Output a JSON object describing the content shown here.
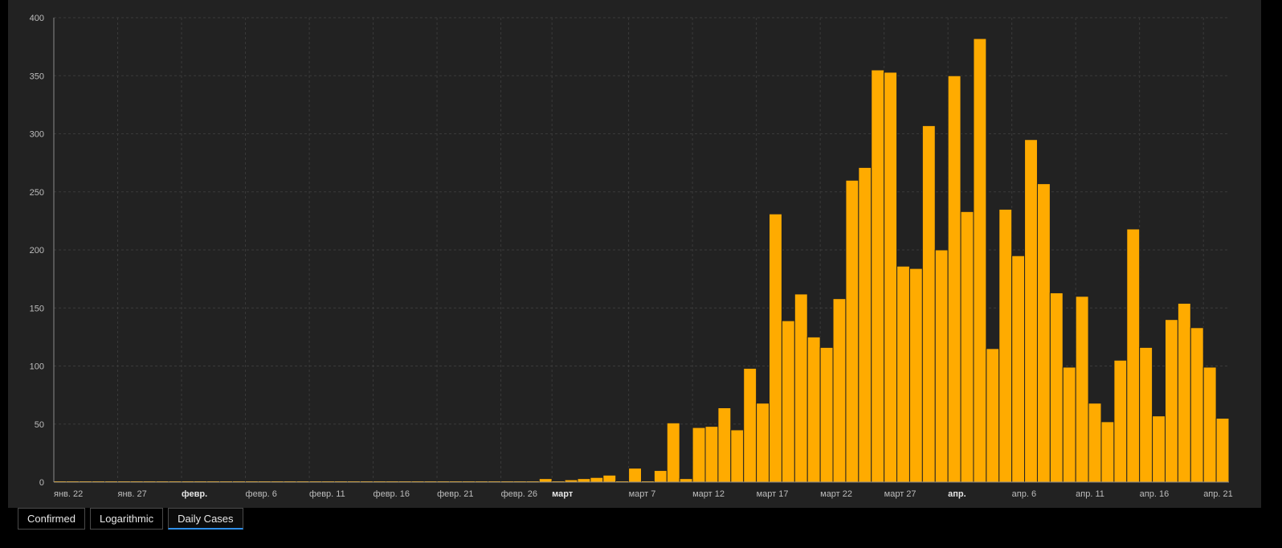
{
  "tabs": [
    {
      "label": "Confirmed",
      "active": false
    },
    {
      "label": "Logarithmic",
      "active": false
    },
    {
      "label": "Daily Cases",
      "active": true
    }
  ],
  "chart_data": {
    "type": "bar",
    "title": "",
    "xlabel": "",
    "ylabel": "",
    "ylim": [
      0,
      400
    ],
    "yticks": [
      0,
      50,
      100,
      150,
      200,
      250,
      300,
      350,
      400
    ],
    "grid": true,
    "bar_color": "#ffab00",
    "background": "#222222",
    "x_tick_labels": [
      {
        "index": 0,
        "label": "янв. 22",
        "major": false
      },
      {
        "index": 5,
        "label": "янв. 27",
        "major": false
      },
      {
        "index": 10,
        "label": "февр.",
        "major": true
      },
      {
        "index": 15,
        "label": "февр. 6",
        "major": false
      },
      {
        "index": 20,
        "label": "февр. 11",
        "major": false
      },
      {
        "index": 25,
        "label": "февр. 16",
        "major": false
      },
      {
        "index": 30,
        "label": "февр. 21",
        "major": false
      },
      {
        "index": 35,
        "label": "февр. 26",
        "major": false
      },
      {
        "index": 39,
        "label": "март",
        "major": true
      },
      {
        "index": 45,
        "label": "март 7",
        "major": false
      },
      {
        "index": 50,
        "label": "март 12",
        "major": false
      },
      {
        "index": 55,
        "label": "март 17",
        "major": false
      },
      {
        "index": 60,
        "label": "март 22",
        "major": false
      },
      {
        "index": 65,
        "label": "март 27",
        "major": false
      },
      {
        "index": 70,
        "label": "апр.",
        "major": true
      },
      {
        "index": 75,
        "label": "апр. 6",
        "major": false
      },
      {
        "index": 80,
        "label": "апр. 11",
        "major": false
      },
      {
        "index": 85,
        "label": "апр. 16",
        "major": false
      },
      {
        "index": 90,
        "label": "апр. 21",
        "major": false
      }
    ],
    "values": [
      0,
      0,
      0,
      0,
      0,
      0,
      0,
      0,
      0,
      0,
      0,
      0,
      0,
      0,
      0,
      0,
      0,
      0,
      0,
      0,
      0,
      0,
      0,
      0,
      0,
      0,
      0,
      0,
      0,
      0,
      0,
      0,
      0,
      0,
      0,
      0,
      0,
      0,
      3,
      0,
      2,
      3,
      4,
      6,
      1,
      12,
      0,
      10,
      51,
      3,
      47,
      48,
      64,
      45,
      98,
      68,
      231,
      139,
      162,
      125,
      116,
      158,
      260,
      271,
      355,
      353,
      186,
      184,
      307,
      200,
      350,
      233,
      382,
      115,
      235,
      195,
      295,
      257,
      163,
      99,
      160,
      68,
      52,
      105,
      218,
      116,
      57,
      140,
      154,
      133,
      99,
      55
    ]
  }
}
